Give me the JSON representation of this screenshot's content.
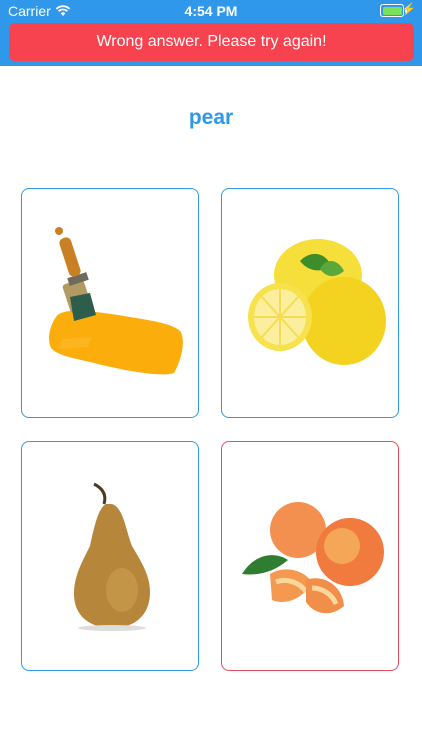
{
  "status_bar": {
    "carrier": "Carrier",
    "time": "4:54 PM",
    "icons": [
      "wifi-icon",
      "battery-icon",
      "charging-bolt-icon"
    ]
  },
  "feedback": {
    "message": "Wrong answer. Please try again!",
    "color": "#f6434f"
  },
  "question": {
    "word": "pear"
  },
  "cards": [
    {
      "image": "paint-brush",
      "state": "default"
    },
    {
      "image": "lemons",
      "state": "default"
    },
    {
      "image": "pear",
      "state": "default"
    },
    {
      "image": "peaches",
      "state": "wrong"
    }
  ],
  "colors": {
    "accent": "#2f98ea",
    "wrong_border": "#e24d60",
    "banner": "#f6434f"
  }
}
